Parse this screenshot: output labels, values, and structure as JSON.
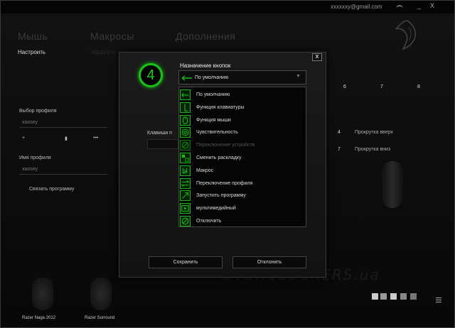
{
  "account": "xxxxxxy@gmail.com",
  "window": {
    "minimize": "_",
    "close": "X"
  },
  "nav": {
    "main": [
      "Мышь",
      "Макросы",
      "Дополнения"
    ],
    "sub_active": "Настроить",
    "sub_dim": "Эффекти"
  },
  "left": {
    "profile_select_label": "Выбор профиля",
    "profile_value": "хаоsеу",
    "plus": "+",
    "profile_name_label": "Имя профиля",
    "profile_name_value": "хаоsеу",
    "link_program": "Связать программу"
  },
  "background_keys": {
    "col1": [
      "6",
      "7",
      "8"
    ],
    "scroll_up": {
      "key": "4",
      "label": "Прокрутка вверх"
    },
    "scroll_down": {
      "key": "7",
      "label": "Прокрутка вниз"
    }
  },
  "devices": [
    "Razer Naga 2012",
    "Razer Surround"
  ],
  "watermark": "OVERCLOCKERS.ua",
  "dialog": {
    "badge": "4",
    "title": "Назначение кнопок",
    "close": "X",
    "selected": "По умолчанию",
    "caret": "▼",
    "mid_label": "Клавиши п",
    "options": [
      {
        "label": "По умолчанию",
        "icon": "default-arrow-icon",
        "disabled": false
      },
      {
        "label": "Функция клавиатуры",
        "icon": "keyboard-function-icon",
        "disabled": false
      },
      {
        "label": "Функция мыши",
        "icon": "mouse-function-icon",
        "disabled": false
      },
      {
        "label": "Чувствительность",
        "icon": "sensitivity-icon",
        "disabled": false
      },
      {
        "label": "Переключение устройств",
        "icon": "device-switch-icon",
        "disabled": true
      },
      {
        "label": "Сменить раскладку",
        "icon": "layout-switch-icon",
        "disabled": false
      },
      {
        "label": "Макрос",
        "icon": "macro-icon",
        "disabled": false
      },
      {
        "label": "Переключение профиля",
        "icon": "profile-switch-icon",
        "disabled": false
      },
      {
        "label": "Запустить программу",
        "icon": "launch-program-icon",
        "disabled": false
      },
      {
        "label": "мультимедийный",
        "icon": "multimedia-icon",
        "disabled": false
      },
      {
        "label": "Отключить",
        "icon": "disable-icon",
        "disabled": false
      }
    ],
    "save": "Сохранить",
    "cancel": "Отклонить"
  },
  "colors": {
    "accent": "#19c119",
    "background": "#0b0b0b"
  }
}
